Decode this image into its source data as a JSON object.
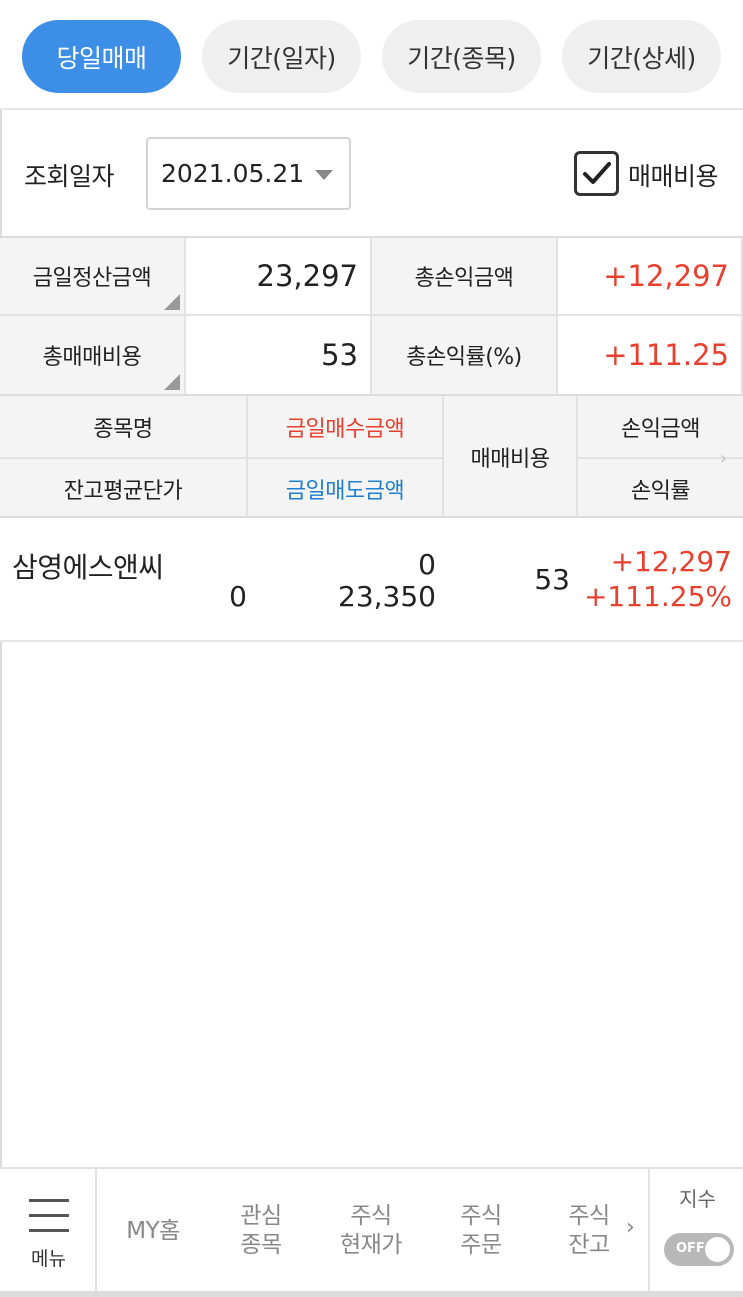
{
  "tabs": [
    {
      "label": "당일매매",
      "active": true
    },
    {
      "label": "기간(일자)",
      "active": false
    },
    {
      "label": "기간(종목)",
      "active": false
    },
    {
      "label": "기간(상세)",
      "active": false
    }
  ],
  "query": {
    "date_label": "조회일자",
    "date_value": "2021.05.21",
    "cost_checkbox_label": "매매비용",
    "cost_checked": true
  },
  "summary": {
    "settle_label": "금일정산금액",
    "settle_value": "23,297",
    "total_pnl_label": "총손익금액",
    "total_pnl_value": "+12,297",
    "total_cost_label": "총매매비용",
    "total_cost_value": "53",
    "total_rate_label": "총손익률(%)",
    "total_rate_value": "+111.25"
  },
  "columns": {
    "name": "종목명",
    "avg_price": "잔고평균단가",
    "buy_amount": "금일매수금액",
    "sell_amount": "금일매도금액",
    "cost": "매매비용",
    "pnl": "손익금액",
    "rate": "손익률",
    "more": "›"
  },
  "rows": [
    {
      "name": "삼영에스앤씨",
      "avg_price": "0",
      "buy_amount": "0",
      "sell_amount": "23,350",
      "cost": "53",
      "pnl": "+12,297",
      "rate": "+111.25%"
    }
  ],
  "bottom_nav": {
    "menu_label": "메뉴",
    "items": [
      "MY홈",
      "관심\n종목",
      "주식\n현재가",
      "주식\n주문",
      "주식\n잔고"
    ],
    "more_arrow": "›",
    "index_label": "지수",
    "index_toggle": "OFF"
  },
  "colors": {
    "accent": "#3d8ee6",
    "up_red": "#e8402f",
    "sell_blue": "#1e7fd0"
  }
}
